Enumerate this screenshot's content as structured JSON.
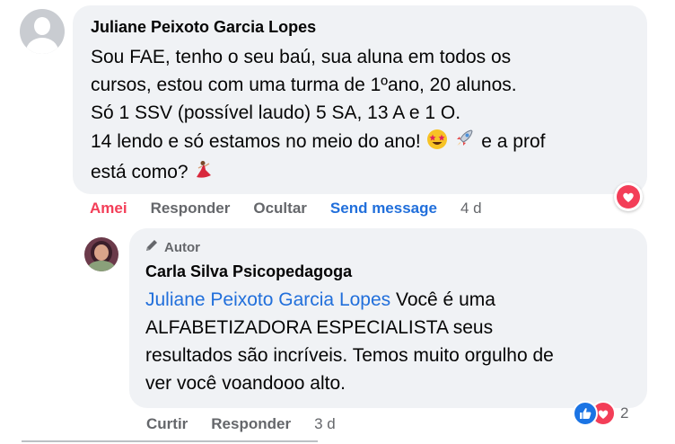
{
  "comment": {
    "author": "Juliane Peixoto Garcia Lopes",
    "lines": [
      "Sou FAE, tenho o seu baú, sua aluna em todos os",
      "cursos, estou com uma turma de 1ºano, 20 alunos.",
      "Só 1 SSV (possível laudo) 5 SA, 13 A e 1 O.",
      "14 lendo e só estamos no meio do ano!",
      "e a prof",
      "está como?"
    ],
    "actions": {
      "liked": "Amei",
      "reply": "Responder",
      "hide": "Ocultar",
      "send_message": "Send message",
      "time": "4 d"
    },
    "reaction_icon": "love-icon"
  },
  "reply": {
    "badge": "Autor",
    "author": "Carla Silva Psicopedagoga",
    "mention": "Juliane Peixoto Garcia Lopes",
    "lines": [
      "Você é uma",
      "ALFABETIZADORA ESPECIALISTA seus",
      "resultados são incríveis. Temos muito orgulho de",
      "ver você voandooo alto."
    ],
    "actions": {
      "like": "Curtir",
      "reply": "Responder",
      "time": "3 d"
    },
    "reaction_count": "2"
  },
  "colors": {
    "bubble": "#f0f2f5",
    "love": "#f33e58",
    "link": "#216fdb",
    "like": "#1b74e4",
    "meta": "#65676b"
  }
}
